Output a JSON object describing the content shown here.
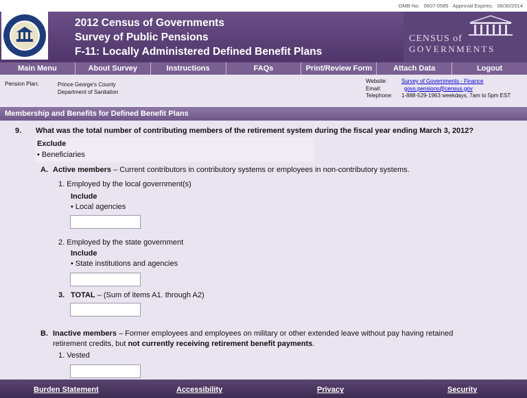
{
  "omb": {
    "number_label": "OMB No:",
    "number": "0607-0585",
    "expires_label": "Approval Expires:",
    "expires": "06/30/2014"
  },
  "header": {
    "title_line1": "2012 Census of Governments",
    "title_line2": "Survey of Public Pensions",
    "title_line3": "F-11:  Locally Administered Defined Benefit Plans",
    "logo_line1": "CENSUS of",
    "logo_line2": "GOVERNMENTS"
  },
  "nav": {
    "items": [
      "Main Menu",
      "About Survey",
      "Instructions",
      "FAQs",
      "Print/Review Form",
      "Attach Data",
      "Logout"
    ]
  },
  "plan": {
    "label": "Pension Plan:",
    "name_line1": "Prince George's County",
    "name_line2": "Department of Sanitation"
  },
  "contact": {
    "website_label": "Website:",
    "website": "Survey of Governments - Finance",
    "email_label": "Email:",
    "email": "govs.pensions@census.gov",
    "phone_label": "Telephone:",
    "phone": "1-888-529-1963  weekdays, 7am to 5pm EST"
  },
  "section": {
    "title": "Membership and Benefits for Defined Benefit Plans"
  },
  "question": {
    "number": "9.",
    "text": "What was the total number of contributing members of  the retirement system during the fiscal year ending  March 3, 2012?",
    "exclude_label": "Exclude",
    "exclude_item": "•  Beneficiaries",
    "a_letter": "A.",
    "a_title": "Active members",
    "a_desc": " – Current contributors in contributory systems or employees in non-contributory systems.",
    "a1": "1.  Employed by the local government(s)",
    "a1_include": "Include",
    "a1_item": "•  Local agencies",
    "a2": "2.  Employed by the state government",
    "a2_include": "Include",
    "a2_item": "•  State institutions and agencies",
    "a3_num": "3.",
    "a3_title": "TOTAL",
    "a3_desc": " – (Sum of items A1. through A2)",
    "b_letter": "B.",
    "b_title": "Inactive members",
    "b_desc": " – Former employees and employees on military or other extended leave without pay having retained",
    "b_desc2": "retirement credits, but ",
    "b_desc2_bold": "not currently receiving retirement benefit payments",
    "b_desc2_end": ".",
    "b1": "1.  Vested"
  },
  "footer": {
    "burden": "Burden Statement",
    "accessibility": "Accessibility",
    "privacy": "Privacy",
    "security": "Security"
  }
}
